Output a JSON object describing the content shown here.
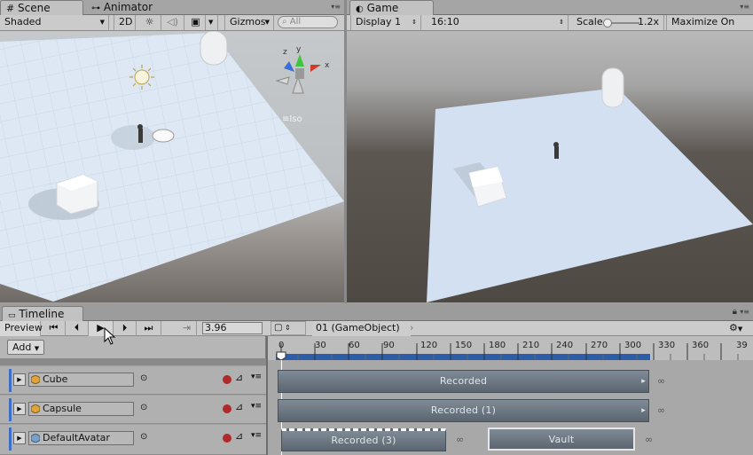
{
  "scene_tabs": {
    "scene": "Scene",
    "animator": "Animator",
    "game": "Game"
  },
  "scene_toolbar": {
    "shading": "Shaded",
    "mode2d": "2D",
    "gizmos": "Gizmos",
    "search_placeholder": "All"
  },
  "game_toolbar": {
    "display": "Display 1",
    "aspect": "16:10",
    "scale_label": "Scale",
    "scale_value": "1.2x",
    "maximize": "Maximize On Play"
  },
  "scene_view": {
    "projection": "Iso",
    "axes": {
      "x": "x",
      "y": "y",
      "z": "z"
    }
  },
  "timeline": {
    "tab": "Timeline",
    "preview": "Preview",
    "time_value": "3.96",
    "add_label": "Add",
    "breadcrumb": "01 (GameObject)",
    "ruler_ticks": [
      "0",
      "30",
      "60",
      "90",
      "120",
      "150",
      "180",
      "210",
      "240",
      "270",
      "300",
      "330",
      "360",
      "39"
    ],
    "tracks": [
      {
        "name": "Cube",
        "clips": [
          {
            "label": "Recorded"
          }
        ],
        "infinity": "∞"
      },
      {
        "name": "Capsule",
        "clips": [
          {
            "label": "Recorded (1)"
          }
        ],
        "infinity": "∞"
      },
      {
        "name": "DefaultAvatar",
        "clips": [
          {
            "label": "Recorded (3)"
          },
          {
            "label": "Vault"
          }
        ],
        "infinity": "∞"
      }
    ]
  },
  "colors": {
    "track_accent": "#3b6ec4",
    "record": "#b02a2a",
    "playhead": "#ffffff",
    "clip": "#66727d"
  }
}
